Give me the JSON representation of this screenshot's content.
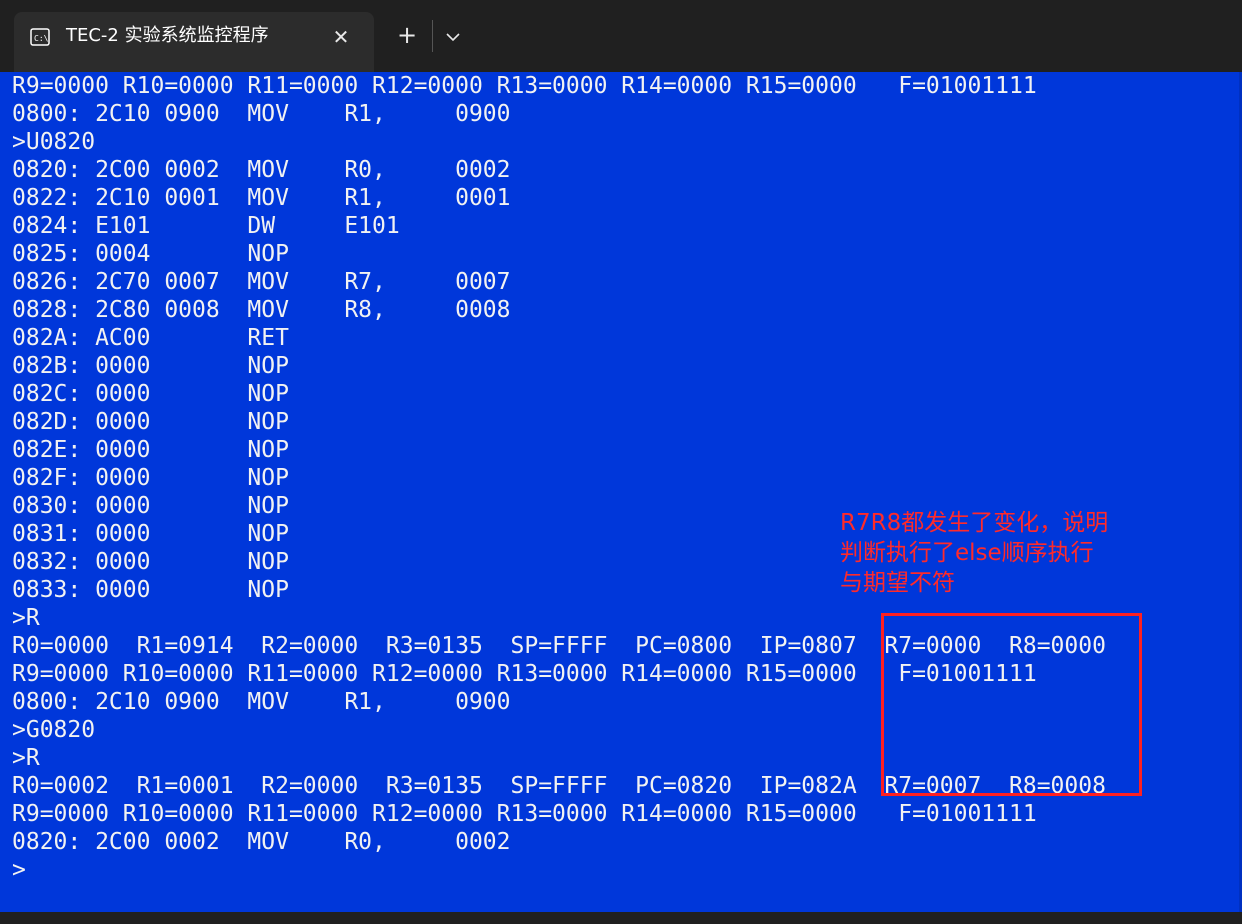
{
  "tab": {
    "title": "TEC-2 实验系统监控程序",
    "close_symbol": "✕",
    "icon": "console-icon"
  },
  "toolbar": {
    "new_tab_symbol": "+",
    "dropdown_icon": "chevron-down-icon"
  },
  "terminal": {
    "background": "#0037da",
    "foreground": "#f2f2f2",
    "lines": [
      "R9=0000 R10=0000 R11=0000 R12=0000 R13=0000 R14=0000 R15=0000   F=01001111",
      "0800: 2C10 0900  MOV    R1,     0900",
      ">U0820",
      "0820: 2C00 0002  MOV    R0,     0002",
      "0822: 2C10 0001  MOV    R1,     0001",
      "0824: E101       DW     E101",
      "0825: 0004       NOP",
      "0826: 2C70 0007  MOV    R7,     0007",
      "0828: 2C80 0008  MOV    R8,     0008",
      "082A: AC00       RET",
      "082B: 0000       NOP",
      "082C: 0000       NOP",
      "082D: 0000       NOP",
      "082E: 0000       NOP",
      "082F: 0000       NOP",
      "0830: 0000       NOP",
      "0831: 0000       NOP",
      "0832: 0000       NOP",
      "0833: 0000       NOP",
      ">R",
      "R0=0000  R1=0914  R2=0000  R3=0135  SP=FFFF  PC=0800  IP=0807  R7=0000  R8=0000",
      "R9=0000 R10=0000 R11=0000 R12=0000 R13=0000 R14=0000 R15=0000   F=01001111",
      "0800: 2C10 0900  MOV    R1,     0900",
      ">G0820",
      ">R",
      "R0=0002  R1=0001  R2=0000  R3=0135  SP=FFFF  PC=0820  IP=082A  R7=0007  R8=0008",
      "R9=0000 R10=0000 R11=0000 R12=0000 R13=0000 R14=0000 R15=0000   F=01001111",
      "0820: 2C00 0002  MOV    R0,     0002",
      ">"
    ]
  },
  "annotation": {
    "color": "#ff2a2a",
    "lines": [
      "R7R8都发生了变化，说明",
      "判断执行了else顺序执行",
      "与期望不符"
    ]
  }
}
